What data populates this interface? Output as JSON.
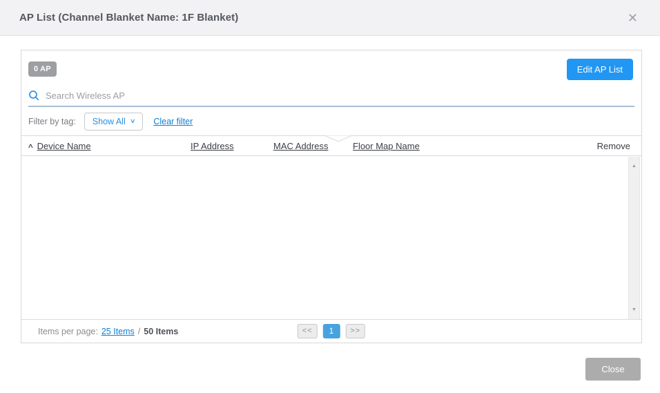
{
  "dialog": {
    "title": "AP List (Channel Blanket Name: 1F Blanket)",
    "close_icon": "✕"
  },
  "icons": {
    "dropdown_caret": "∨",
    "sort_asc": "∧",
    "scroll_up": "▲",
    "scroll_down": "▼"
  },
  "panel": {
    "ap_count_badge": "0 AP",
    "edit_button_label": "Edit AP List",
    "search": {
      "placeholder": "Search Wireless AP"
    },
    "filter": {
      "label": "Filter by tag:",
      "dropdown_value": "Show All",
      "clear_link": "Clear filter"
    },
    "table": {
      "columns": [
        {
          "label": "Device Name",
          "sortable": true,
          "sort": "asc"
        },
        {
          "label": "IP Address",
          "sortable": true
        },
        {
          "label": "MAC Address",
          "sortable": true
        },
        {
          "label": "Floor Map Name",
          "sortable": true
        },
        {
          "label": "Remove",
          "sortable": false
        }
      ],
      "rows": []
    },
    "footer": {
      "items_per_page_label": "Items per page:",
      "items_per_page_link": "25 Items",
      "separator": "/",
      "total_label": "50 Items",
      "pagination": {
        "prev": "<<",
        "current": "1",
        "next": ">>"
      }
    }
  },
  "actions": {
    "close_button": "Close"
  },
  "colors": {
    "primary_blue": "#2196f3",
    "active_page_blue": "#47a3de",
    "link_blue": "#0d7fd6",
    "badge_gray": "#9d9fa2",
    "close_button_gray": "#acacac",
    "search_underline_blue_gray": "#a7bcd2",
    "dialog_header_bg": "#f2f2f4"
  }
}
